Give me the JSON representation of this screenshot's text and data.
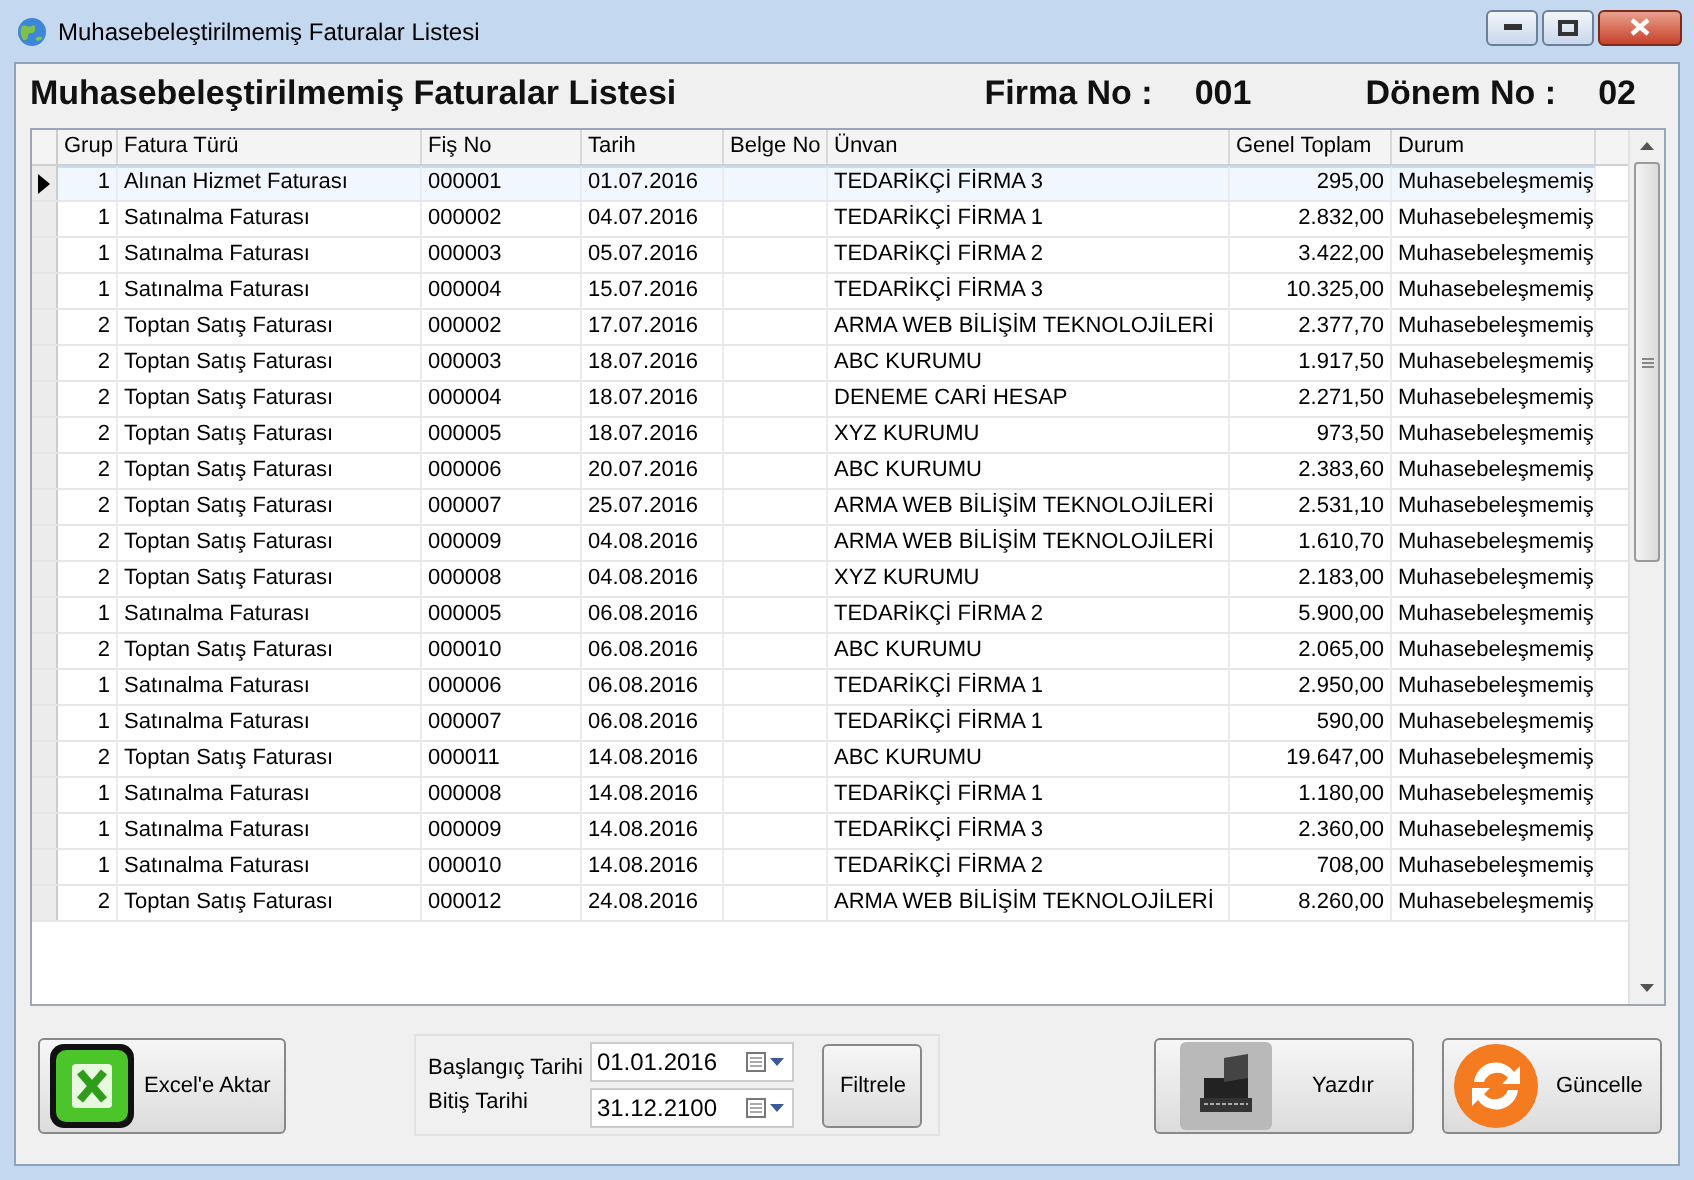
{
  "window": {
    "title": "Muhasebeleştirilmemiş Faturalar Listesi"
  },
  "header": {
    "title": "Muhasebeleştirilmemiş Faturalar Listesi",
    "firma_label": "Firma No :",
    "firma_value": "001",
    "donem_label": "Dönem No :",
    "donem_value": "02"
  },
  "table": {
    "columns": [
      "Grup",
      "Fatura Türü",
      "Fiş No",
      "Tarih",
      "Belge No",
      "Ünvan",
      "Genel Toplam",
      "Durum"
    ],
    "rows": [
      {
        "selected": true,
        "cells": [
          "1",
          "Alınan Hizmet Faturası",
          "000001",
          "01.07.2016",
          "",
          "TEDARİKÇİ FİRMA 3",
          "295,00",
          "Muhasebeleşmemiş"
        ]
      },
      {
        "selected": false,
        "cells": [
          "1",
          "Satınalma Faturası",
          "000002",
          "04.07.2016",
          "",
          "TEDARİKÇİ FİRMA 1",
          "2.832,00",
          "Muhasebeleşmemiş"
        ]
      },
      {
        "selected": false,
        "cells": [
          "1",
          "Satınalma Faturası",
          "000003",
          "05.07.2016",
          "",
          "TEDARİKÇİ FİRMA 2",
          "3.422,00",
          "Muhasebeleşmemiş"
        ]
      },
      {
        "selected": false,
        "cells": [
          "1",
          "Satınalma Faturası",
          "000004",
          "15.07.2016",
          "",
          "TEDARİKÇİ FİRMA 3",
          "10.325,00",
          "Muhasebeleşmemiş"
        ]
      },
      {
        "selected": false,
        "cells": [
          "2",
          "Toptan Satış Faturası",
          "000002",
          "17.07.2016",
          "",
          "ARMA WEB BİLİŞİM TEKNOLOJİLERİ",
          "2.377,70",
          "Muhasebeleşmemiş"
        ]
      },
      {
        "selected": false,
        "cells": [
          "2",
          "Toptan Satış Faturası",
          "000003",
          "18.07.2016",
          "",
          "ABC KURUMU",
          "1.917,50",
          "Muhasebeleşmemiş"
        ]
      },
      {
        "selected": false,
        "cells": [
          "2",
          "Toptan Satış Faturası",
          "000004",
          "18.07.2016",
          "",
          "DENEME CARİ HESAP",
          "2.271,50",
          "Muhasebeleşmemiş"
        ]
      },
      {
        "selected": false,
        "cells": [
          "2",
          "Toptan Satış Faturası",
          "000005",
          "18.07.2016",
          "",
          "XYZ KURUMU",
          "973,50",
          "Muhasebeleşmemiş"
        ]
      },
      {
        "selected": false,
        "cells": [
          "2",
          "Toptan Satış Faturası",
          "000006",
          "20.07.2016",
          "",
          "ABC KURUMU",
          "2.383,60",
          "Muhasebeleşmemiş"
        ]
      },
      {
        "selected": false,
        "cells": [
          "2",
          "Toptan Satış Faturası",
          "000007",
          "25.07.2016",
          "",
          "ARMA WEB BİLİŞİM TEKNOLOJİLERİ",
          "2.531,10",
          "Muhasebeleşmemiş"
        ]
      },
      {
        "selected": false,
        "cells": [
          "2",
          "Toptan Satış Faturası",
          "000009",
          "04.08.2016",
          "",
          "ARMA WEB BİLİŞİM TEKNOLOJİLERİ",
          "1.610,70",
          "Muhasebeleşmemiş"
        ]
      },
      {
        "selected": false,
        "cells": [
          "2",
          "Toptan Satış Faturası",
          "000008",
          "04.08.2016",
          "",
          "XYZ KURUMU",
          "2.183,00",
          "Muhasebeleşmemiş"
        ]
      },
      {
        "selected": false,
        "cells": [
          "1",
          "Satınalma Faturası",
          "000005",
          "06.08.2016",
          "",
          "TEDARİKÇİ FİRMA 2",
          "5.900,00",
          "Muhasebeleşmemiş"
        ]
      },
      {
        "selected": false,
        "cells": [
          "2",
          "Toptan Satış Faturası",
          "000010",
          "06.08.2016",
          "",
          "ABC KURUMU",
          "2.065,00",
          "Muhasebeleşmemiş"
        ]
      },
      {
        "selected": false,
        "cells": [
          "1",
          "Satınalma Faturası",
          "000006",
          "06.08.2016",
          "",
          "TEDARİKÇİ FİRMA 1",
          "2.950,00",
          "Muhasebeleşmemiş"
        ]
      },
      {
        "selected": false,
        "cells": [
          "1",
          "Satınalma Faturası",
          "000007",
          "06.08.2016",
          "",
          "TEDARİKÇİ FİRMA 1",
          "590,00",
          "Muhasebeleşmemiş"
        ]
      },
      {
        "selected": false,
        "cells": [
          "2",
          "Toptan Satış Faturası",
          "000011",
          "14.08.2016",
          "",
          "ABC KURUMU",
          "19.647,00",
          "Muhasebeleşmemiş"
        ]
      },
      {
        "selected": false,
        "cells": [
          "1",
          "Satınalma Faturası",
          "000008",
          "14.08.2016",
          "",
          "TEDARİKÇİ FİRMA 1",
          "1.180,00",
          "Muhasebeleşmemiş"
        ]
      },
      {
        "selected": false,
        "cells": [
          "1",
          "Satınalma Faturası",
          "000009",
          "14.08.2016",
          "",
          "TEDARİKÇİ FİRMA 3",
          "2.360,00",
          "Muhasebeleşmemiş"
        ]
      },
      {
        "selected": false,
        "cells": [
          "1",
          "Satınalma Faturası",
          "000010",
          "14.08.2016",
          "",
          "TEDARİKÇİ FİRMA 2",
          "708,00",
          "Muhasebeleşmemiş"
        ]
      },
      {
        "selected": false,
        "cells": [
          "2",
          "Toptan Satış Faturası",
          "000012",
          "24.08.2016",
          "",
          "ARMA WEB BİLİŞİM TEKNOLOJİLERİ",
          "8.260,00",
          "Muhasebeleşmemiş"
        ]
      }
    ]
  },
  "footer": {
    "excel_button": "Excel'e Aktar",
    "start_label": "Başlangıç Tarihi",
    "start_value": "01.01.2016",
    "end_label": "Bitiş Tarihi",
    "end_value": "31.12.2100",
    "filter_button": "Filtrele",
    "print_button": "Yazdır",
    "refresh_button": "Güncelle"
  }
}
